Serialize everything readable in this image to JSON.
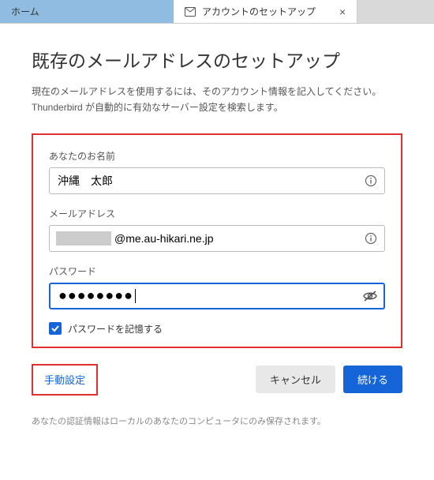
{
  "tabs": {
    "home": "ホーム",
    "setup": "アカウントのセットアップ"
  },
  "heading": "既存のメールアドレスのセットアップ",
  "description_line1": "現在のメールアドレスを使用するには、そのアカウント情報を記入してください。",
  "description_line2": "Thunderbird が自動的に有効なサーバー設定を検索します。",
  "form": {
    "name_label": "あなたのお名前",
    "name_value": "沖縄　太郎",
    "email_label": "メールアドレス",
    "email_domain": "@me.au-hikari.ne.jp",
    "password_label": "パスワード",
    "password_masked": "●●●●●●●●",
    "remember_label": "パスワードを記憶する"
  },
  "actions": {
    "manual": "手動設定",
    "cancel": "キャンセル",
    "continue": "続ける"
  },
  "footer": "あなたの認証情報はローカルのあなたのコンピュータにのみ保存されます。"
}
